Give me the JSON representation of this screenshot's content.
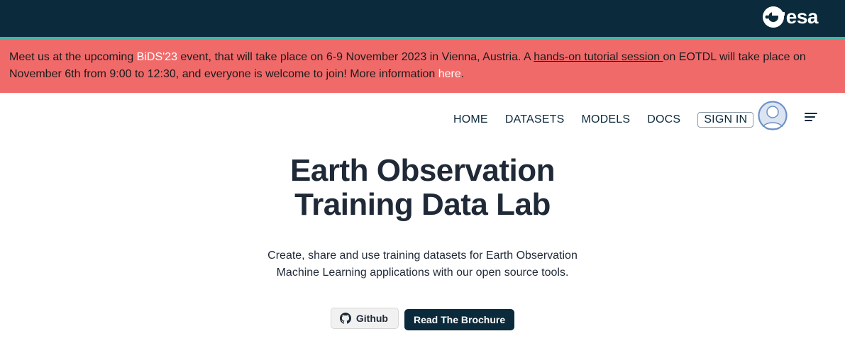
{
  "brand": {
    "name": "esa"
  },
  "banner": {
    "part1": "Meet us at the upcoming ",
    "event_link": "BiDS'23",
    "part2": " event, that will take place on 6-9 November 2023 in Vienna, Austria. A ",
    "tutorial_link": "hands-on tutorial session ",
    "part3": "on EOTDL will take place on November 6th from 9:00 to 12:30, and everyone is welcome to join! More information ",
    "here_link": "here",
    "part4": "."
  },
  "nav": {
    "home": "HOME",
    "datasets": "DATASETS",
    "models": "MODELS",
    "docs": "DOCS",
    "signin": "SIGN IN",
    "avatar_icon": "user-avatar-icon",
    "menu_icon": "menu-icon"
  },
  "hero": {
    "title_line1": "Earth Observation",
    "title_line2": "Training Data Lab",
    "subtitle": "Create, share and use training datasets for Earth Observation Machine Learning applications with our open source tools."
  },
  "buttons": {
    "github": "Github",
    "github_icon": "github-icon",
    "brochure": "Read The Brochure"
  },
  "colors": {
    "topbar": "#0b2a3b",
    "accent_stripe": "#3fb7a8",
    "banner": "#f16a6a",
    "primary_button": "#0b2a3b"
  }
}
